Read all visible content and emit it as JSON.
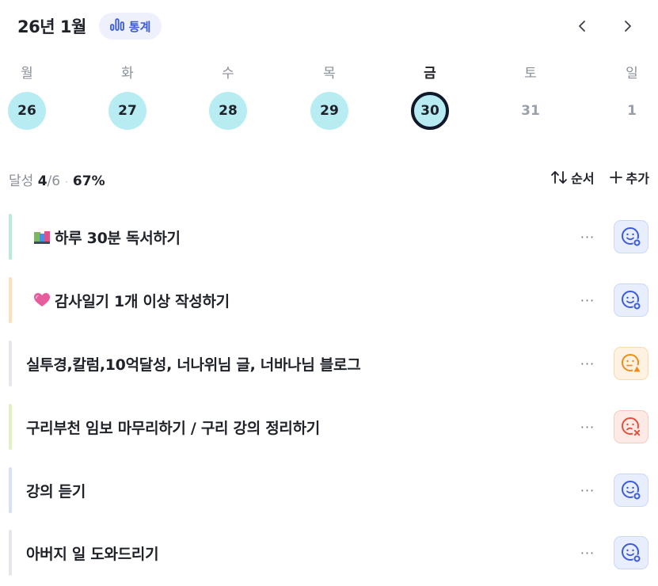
{
  "header": {
    "title": "26년 1월",
    "stats_label": "통계"
  },
  "weekdays": [
    {
      "label": "월",
      "date": "26",
      "state": "filled"
    },
    {
      "label": "화",
      "date": "27",
      "state": "filled"
    },
    {
      "label": "수",
      "date": "28",
      "state": "filled"
    },
    {
      "label": "목",
      "date": "29",
      "state": "filled"
    },
    {
      "label": "금",
      "date": "30",
      "state": "today"
    },
    {
      "label": "토",
      "date": "31",
      "state": "future"
    },
    {
      "label": "일",
      "date": "1",
      "state": "future"
    }
  ],
  "summary": {
    "label": "달성",
    "done": "4",
    "total": "/6",
    "separator": "·",
    "percent": "67%"
  },
  "actions": {
    "sort_label": "순서",
    "add_label": "추가"
  },
  "tasks": [
    {
      "emoji": "books-icon",
      "label": "하루 30분 독서하기",
      "more": "···",
      "status": "done",
      "bar_color": "#b7ecd9"
    },
    {
      "emoji": "heart-icon",
      "label": "감사일기 1개 이상 작성하기",
      "more": "···",
      "status": "done",
      "bar_color": "#fde0b8"
    },
    {
      "emoji": null,
      "label": "실투경,칼럼,10억달성, 너나위님 글, 너바나님 블로그",
      "more": "···",
      "status": "partial",
      "bar_color": "#e6e7ea"
    },
    {
      "emoji": null,
      "label": "구리부천 임보 마무리하기 / 구리 강의 정리하기",
      "more": "···",
      "status": "failed",
      "bar_color": "#dff2c0"
    },
    {
      "emoji": null,
      "label": "강의 듣기",
      "more": "···",
      "status": "done",
      "bar_color": "#d7e1f6"
    },
    {
      "emoji": null,
      "label": "아버지 일 도와드리기",
      "more": "···",
      "status": "done",
      "bar_color": "#e6e7ea"
    }
  ],
  "colors": {
    "accent": "#3b5bd9",
    "date_fill": "#b8ecf3",
    "today_ring": "#111a2b",
    "status_done": "#3b5bd9",
    "status_partial": "#f08c1a",
    "status_failed": "#e4513b"
  }
}
